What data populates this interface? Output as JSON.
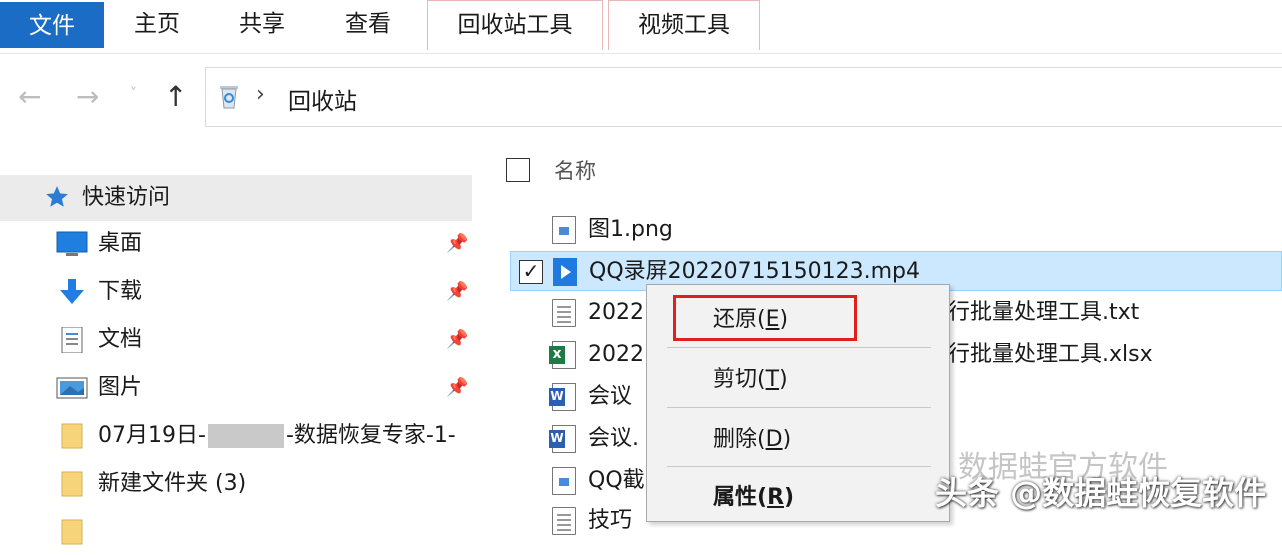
{
  "ribbon": {
    "tabs": [
      {
        "label": "文件"
      },
      {
        "label": "主页"
      },
      {
        "label": "共享"
      },
      {
        "label": "查看"
      },
      {
        "label": "回收站工具"
      },
      {
        "label": "视频工具"
      }
    ]
  },
  "address": {
    "separator": "›",
    "path": "回收站"
  },
  "nav": {
    "quick_access": "快速访问",
    "items": [
      {
        "label": "桌面",
        "icon": "desktop-icon",
        "pinned": true
      },
      {
        "label": "下载",
        "icon": "download-icon",
        "pinned": true
      },
      {
        "label": "文档",
        "icon": "documents-icon",
        "pinned": true
      },
      {
        "label": "图片",
        "icon": "pictures-icon",
        "pinned": true
      },
      {
        "label_prefix": "07月19日-",
        "label_suffix": "-数据恢复专家-1-",
        "icon": "folder-icon"
      },
      {
        "label": "新建文件夹 (3)",
        "icon": "folder-icon"
      }
    ]
  },
  "list": {
    "header": "名称",
    "files": [
      {
        "name": "图1.png",
        "icon": "image-file-icon"
      },
      {
        "name": "QQ录屏20220715150123.mp4",
        "icon": "video-file-icon",
        "selected": true,
        "checked": "✓"
      },
      {
        "name": "2022",
        "tail": "行批量处理工具.txt",
        "icon": "text-file-icon"
      },
      {
        "name": "2022",
        "tail": "行批量处理工具.xlsx",
        "icon": "excel-file-icon"
      },
      {
        "name": "会议",
        "icon": "word-file-icon"
      },
      {
        "name": "会议.",
        "icon": "word-file-icon"
      },
      {
        "name": "QQ截",
        "icon": "image-file-icon"
      },
      {
        "name": "技巧",
        "icon": "text-file-icon"
      }
    ]
  },
  "context_menu": {
    "restore": "还原",
    "restore_key": "E",
    "cut": "剪切",
    "cut_key": "T",
    "delete": "删除",
    "delete_key": "D",
    "properties": "属性",
    "properties_key": "R"
  },
  "watermark": {
    "top": "数据蛙官方软件",
    "bottom": "头条 @数据蛙恢复软件"
  },
  "colors": {
    "file_tab": "#1a6cc4",
    "selection": "#cce8ff",
    "highlight_box": "#e02020"
  }
}
